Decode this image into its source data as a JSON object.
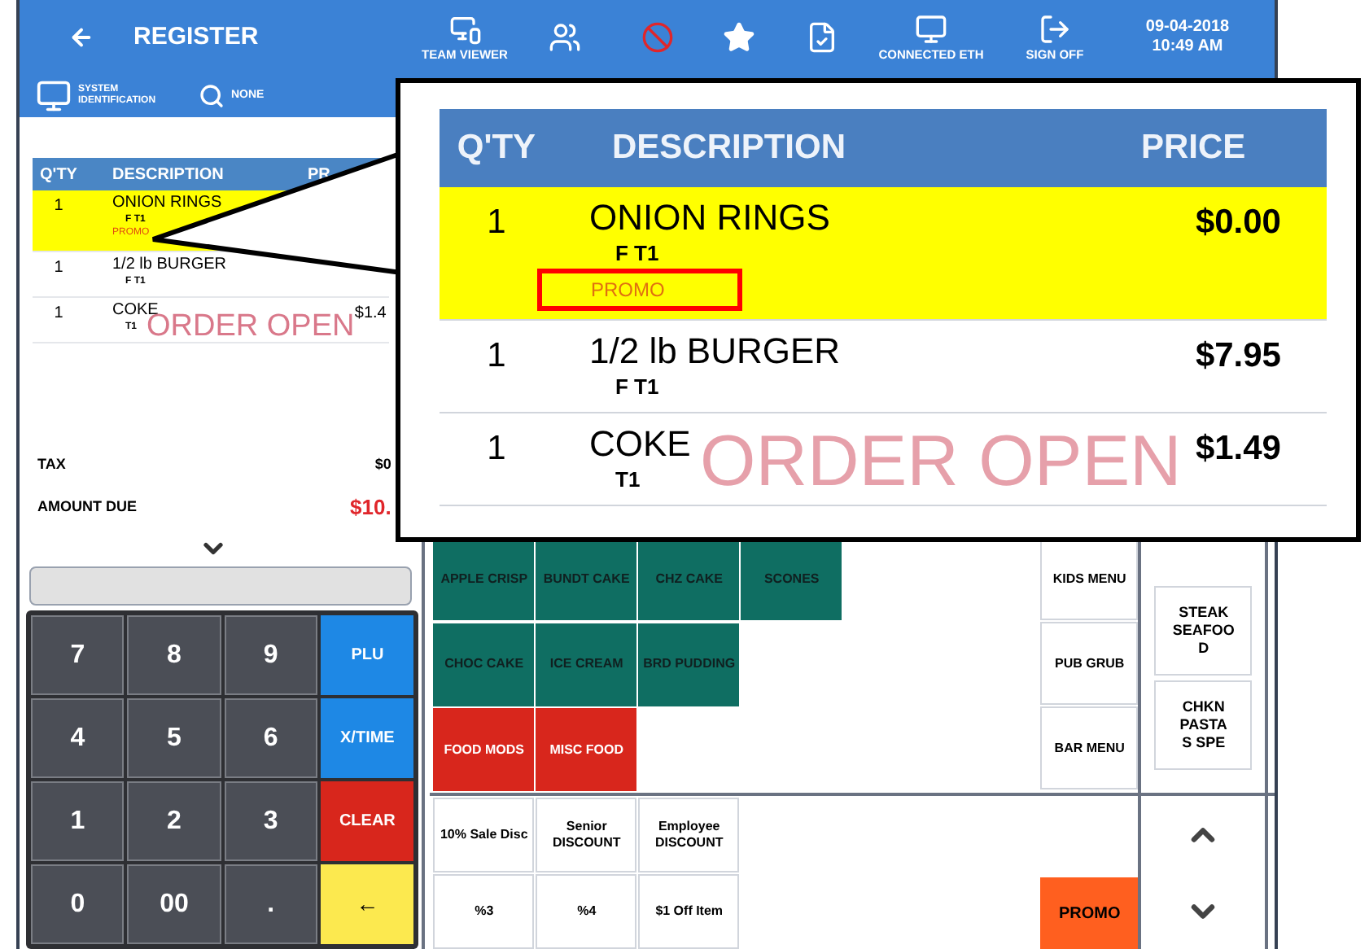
{
  "header": {
    "title": "REGISTER",
    "tools": [
      {
        "kind": "team-viewer",
        "label": "TEAM VIEWER"
      },
      {
        "kind": "tables"
      },
      {
        "kind": "no-sign"
      },
      {
        "kind": "star"
      },
      {
        "kind": "document"
      },
      {
        "kind": "network",
        "label": "CONNECTED ETH"
      },
      {
        "kind": "sign-off",
        "label": "SIGN OFF"
      }
    ],
    "date": "09-04-2018",
    "time": "10:49 AM",
    "system_id": "SYSTEM IDENTIFICATION",
    "search": "NONE"
  },
  "order": {
    "columns": [
      "Q'TY",
      "DESCRIPTION",
      "PR"
    ],
    "rows": [
      {
        "qty": "1",
        "description": "ONION RINGS",
        "notes": [
          "F T1"
        ],
        "promo": "PROMO",
        "selected": true
      },
      {
        "qty": "1",
        "description": "1/2 lb BURGER",
        "notes": [
          "F T1"
        ],
        "selected": false
      },
      {
        "qty": "1",
        "description": "COKE",
        "notes": [
          "T1"
        ],
        "price": "$1.4",
        "selected": false
      }
    ],
    "watermark": "ORDER OPEN",
    "totals": [
      {
        "kind": "plain",
        "label": "TAX",
        "value": "$0"
      },
      {
        "kind": "due",
        "label": "AMOUNT DUE",
        "value": "$10."
      }
    ]
  },
  "keypad": [
    {
      "kind": "digit",
      "label": "7"
    },
    {
      "kind": "digit",
      "label": "8"
    },
    {
      "kind": "digit",
      "label": "9"
    },
    {
      "kind": "blue",
      "label": "PLU"
    },
    {
      "kind": "digit",
      "label": "4"
    },
    {
      "kind": "digit",
      "label": "5"
    },
    {
      "kind": "digit",
      "label": "6"
    },
    {
      "kind": "blue",
      "label": "X/TIME"
    },
    {
      "kind": "digit",
      "label": "1"
    },
    {
      "kind": "digit",
      "label": "2"
    },
    {
      "kind": "digit",
      "label": "3"
    },
    {
      "kind": "red",
      "label": "CLEAR"
    },
    {
      "kind": "digit",
      "label": "0"
    },
    {
      "kind": "digit",
      "label": "00"
    },
    {
      "kind": "digit",
      "label": "."
    },
    {
      "kind": "yellow",
      "label": "←"
    }
  ],
  "menu": {
    "items": [
      {
        "kind": "teal",
        "label": "APPLE CRISP"
      },
      {
        "kind": "teal",
        "label": "BUNDT CAKE"
      },
      {
        "kind": "teal",
        "label": "CHZ CAKE"
      },
      {
        "kind": "teal",
        "label": "SCONES"
      },
      {
        "kind": "teal",
        "label": "CHOC CAKE"
      },
      {
        "kind": "teal",
        "label": "ICE CREAM"
      },
      {
        "kind": "teal",
        "label": "BRD PUDDING"
      },
      {
        "kind": "empty"
      },
      {
        "kind": "red",
        "label": "FOOD MODS"
      },
      {
        "kind": "red",
        "label": "MISC FOOD"
      }
    ],
    "categories": [
      "KIDS MENU",
      "PUB GRUB",
      "BAR MENU"
    ],
    "side": [
      {
        "lines": [
          "STEAK",
          "SEAFOO",
          "D"
        ]
      },
      {
        "lines": [
          "CHKN",
          "PASTA",
          "S SPE"
        ]
      }
    ],
    "discounts": [
      "10% Sale Disc",
      "Senior DISCOUNT",
      "Employee DISCOUNT",
      "%3",
      "%4",
      "$1 Off Item"
    ],
    "promo": "PROMO"
  },
  "callout": {
    "columns": [
      "Q'TY",
      "DESCRIPTION",
      "PRICE"
    ],
    "rows": [
      {
        "qty": "1",
        "description": "ONION RINGS",
        "notes": [
          "F T1"
        ],
        "promo": "PROMO",
        "promo_highlighted": true,
        "price": "$0.00",
        "selected": true
      },
      {
        "qty": "1",
        "description": "1/2 lb BURGER",
        "notes": [
          "F T1"
        ],
        "price": "$7.95",
        "selected": false
      },
      {
        "qty": "1",
        "description": "COKE",
        "notes": [
          "T1"
        ],
        "price": "$1.49",
        "selected": false
      }
    ],
    "watermark": "ORDER OPEN"
  }
}
